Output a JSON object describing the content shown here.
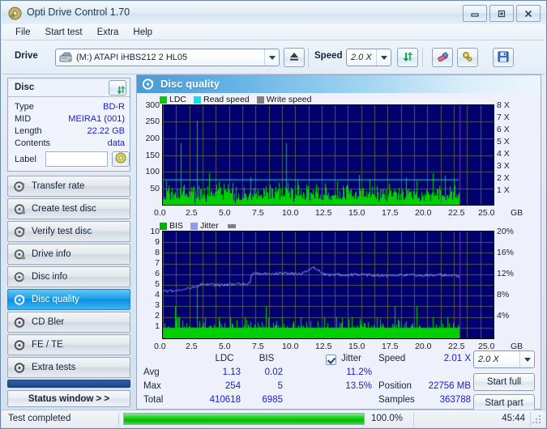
{
  "window": {
    "title": "Opti Drive Control 1.70",
    "icon": "app-disc-icon",
    "buttons": {
      "minimize": "minimize-icon",
      "maximize": "maximize-icon",
      "close": "close-icon"
    }
  },
  "menu": {
    "items": [
      "File",
      "Start test",
      "Extra",
      "Help"
    ]
  },
  "toolbar": {
    "drive_label": "Drive",
    "drive_value": "(M:)  ATAPI iHBS212  2 HL05",
    "eject_icon": "eject-icon",
    "speed_label": "Speed",
    "speed_value": "2.0 X",
    "refresh_icon": "refresh-arrows-icon",
    "erase_icon": "eraser-icon",
    "settings_icon": "tools-icon",
    "save_icon": "floppy-save-icon"
  },
  "disc_panel": {
    "title": "Disc",
    "refresh_icon": "refresh-arrows-icon",
    "rows": [
      {
        "key": "Type",
        "value": "BD-R"
      },
      {
        "key": "MID",
        "value": "MEIRA1 (001)"
      },
      {
        "key": "Length",
        "value": "22.22 GB"
      },
      {
        "key": "Contents",
        "value": "data"
      }
    ],
    "label_key": "Label",
    "label_value": "",
    "label_placeholder": "",
    "label_icon": "disc-icon"
  },
  "sidebar": {
    "items": [
      {
        "label": "Transfer rate",
        "icon": "disc-speed-icon",
        "active": false
      },
      {
        "label": "Create test disc",
        "icon": "disc-burn-icon",
        "active": false
      },
      {
        "label": "Verify test disc",
        "icon": "disc-check-icon",
        "active": false
      },
      {
        "label": "Drive info",
        "icon": "drive-info-icon",
        "active": false
      },
      {
        "label": "Disc info",
        "icon": "disc-info-icon",
        "active": false
      },
      {
        "label": "Disc quality",
        "icon": "disc-quality-icon",
        "active": true
      },
      {
        "label": "CD Bler",
        "icon": "disc-bler-icon",
        "active": false
      },
      {
        "label": "FE / TE",
        "icon": "disc-fete-icon",
        "active": false
      },
      {
        "label": "Extra tests",
        "icon": "disc-extra-icon",
        "active": false
      }
    ],
    "status_window_button": "Status window > >"
  },
  "panel": {
    "header_title": "Disc quality",
    "header_icon": "disc-quality-icon"
  },
  "stats": {
    "col_headers": [
      "LDC",
      "BIS"
    ],
    "jitter_label": "Jitter",
    "jitter_checked": true,
    "rows": [
      {
        "name": "Avg",
        "ldc": "1.13",
        "bis": "0.02",
        "jitter": "11.2%"
      },
      {
        "name": "Max",
        "ldc": "254",
        "bis": "5",
        "jitter": "13.5%"
      },
      {
        "name": "Total",
        "ldc": "410618",
        "bis": "6985",
        "jitter": ""
      }
    ],
    "right": [
      {
        "key": "Speed",
        "value": "2.01 X"
      },
      {
        "key": "Position",
        "value": "22756 MB"
      },
      {
        "key": "Samples",
        "value": "363788"
      }
    ],
    "speed_select": "2.0 X",
    "start_full": "Start full",
    "start_part": "Start part"
  },
  "statusbar": {
    "message": "Test completed",
    "percent": "100.0%",
    "percent_value": 100,
    "elapsed": "45:44"
  },
  "chart_data": [
    {
      "id": "top-chart",
      "type": "line",
      "title": "LDC / Read speed",
      "legend": [
        {
          "name": "LDC",
          "color": "#00d000"
        },
        {
          "name": "Read speed",
          "color": "#00e5e5"
        },
        {
          "name": "Write speed",
          "color": "#808080"
        }
      ],
      "legend_position": "top-left",
      "xlabel": "GB",
      "xlim": [
        0,
        25
      ],
      "xticks": [
        0.0,
        2.5,
        5.0,
        7.5,
        10.0,
        12.5,
        15.0,
        17.5,
        20.0,
        22.5,
        25.0
      ],
      "xticklabels": [
        "0.0",
        "2.5",
        "5.0",
        "7.5",
        "10.0",
        "12.5",
        "15.0",
        "17.5",
        "20.0",
        "22.5",
        "25.0"
      ],
      "ylabel_left": "LDC",
      "ylim_left": [
        0,
        300
      ],
      "yticks_left": [
        50,
        100,
        150,
        200,
        250,
        300
      ],
      "yticklabels_left": [
        "50",
        "100",
        "150",
        "200",
        "250",
        "300"
      ],
      "ylabel_right": "X",
      "ylim_right": [
        0,
        8
      ],
      "yticks_right": [
        1,
        2,
        3,
        4,
        5,
        6,
        7,
        8
      ],
      "yticklabels_right": [
        "1 X",
        "2 X",
        "3 X",
        "4 X",
        "5 X",
        "6 X",
        "7 X",
        "8 X"
      ],
      "grid": true,
      "plot_bg": "#00006e",
      "data_end_marker_x": 22.4,
      "data_end_marker_color": "#d000d0",
      "series": [
        {
          "name": "Read speed",
          "color": "#00e5e5",
          "axis": "right",
          "kind": "line",
          "x": [
            0.05,
            1.0,
            3.0,
            6.0,
            9.0,
            12.0,
            15.0,
            18.0,
            21.0,
            22.4
          ],
          "values": [
            2.01,
            2.01,
            2.01,
            2.01,
            2.01,
            2.01,
            2.01,
            2.01,
            2.01,
            2.01
          ]
        },
        {
          "name": "LDC",
          "color": "#00d000",
          "axis": "left",
          "kind": "spike",
          "baseline": 14,
          "avg": 1.13,
          "max": 254,
          "notable_spikes": [
            {
              "x": 0.25,
              "y": 72
            },
            {
              "x": 0.45,
              "y": 58
            },
            {
              "x": 1.35,
              "y": 186
            },
            {
              "x": 2.6,
              "y": 254
            },
            {
              "x": 3.5,
              "y": 96
            },
            {
              "x": 4.2,
              "y": 70
            },
            {
              "x": 5.3,
              "y": 66
            },
            {
              "x": 6.6,
              "y": 84
            },
            {
              "x": 8.1,
              "y": 60
            },
            {
              "x": 9.3,
              "y": 186
            },
            {
              "x": 10.2,
              "y": 74
            },
            {
              "x": 11.6,
              "y": 62
            },
            {
              "x": 13.2,
              "y": 70
            },
            {
              "x": 14.8,
              "y": 90
            },
            {
              "x": 15.6,
              "y": 76
            },
            {
              "x": 17.1,
              "y": 64
            },
            {
              "x": 18.4,
              "y": 82
            },
            {
              "x": 19.2,
              "y": 72
            },
            {
              "x": 20.4,
              "y": 96
            },
            {
              "x": 21.3,
              "y": 88
            },
            {
              "x": 22.0,
              "y": 74
            }
          ]
        }
      ]
    },
    {
      "id": "bottom-chart",
      "type": "line",
      "title": "BIS / Jitter",
      "legend": [
        {
          "name": "BIS",
          "color": "#00b200"
        },
        {
          "name": "Jitter",
          "color": "#8f9cf0"
        }
      ],
      "legend_position": "top-left",
      "xlabel": "GB",
      "xlim": [
        0,
        25
      ],
      "xticks": [
        0.0,
        2.5,
        5.0,
        7.5,
        10.0,
        12.5,
        15.0,
        17.5,
        20.0,
        22.5,
        25.0
      ],
      "xticklabels": [
        "0.0",
        "2.5",
        "5.0",
        "7.5",
        "10.0",
        "12.5",
        "15.0",
        "17.5",
        "20.0",
        "22.5",
        "25.0"
      ],
      "ylabel_left": "BIS",
      "ylim_left": [
        0,
        10
      ],
      "yticks_left": [
        1,
        2,
        3,
        4,
        5,
        6,
        7,
        8,
        9,
        10
      ],
      "yticklabels_left": [
        "1",
        "2",
        "3",
        "4",
        "5",
        "6",
        "7",
        "8",
        "9",
        "10"
      ],
      "ylabel_right": "%",
      "ylim_right": [
        0,
        20
      ],
      "yticks_right": [
        4,
        8,
        12,
        16,
        20
      ],
      "yticklabels_right": [
        "4%",
        "8%",
        "12%",
        "16%",
        "20%"
      ],
      "grid": true,
      "plot_bg": "#00006e",
      "data_end_marker_x": 22.4,
      "data_end_marker_color": "#d000d0",
      "series": [
        {
          "name": "Jitter",
          "color": "#8f9cf0",
          "axis": "right",
          "kind": "line",
          "x": [
            0.1,
            1.0,
            2.0,
            2.9,
            4.0,
            5.0,
            6.0,
            6.55,
            6.7,
            7.5,
            8.5,
            9.5,
            10.5,
            11.4,
            11.8,
            12.3,
            13.0,
            14.0,
            15.0,
            16.0,
            17.0,
            18.0,
            19.0,
            20.0,
            21.0,
            22.0,
            22.4
          ],
          "values": [
            8.8,
            9.0,
            9.4,
            10.1,
            10.0,
            10.1,
            10.1,
            10.2,
            12.0,
            12.1,
            12.1,
            12.2,
            12.1,
            13.2,
            12.6,
            11.9,
            11.9,
            11.9,
            11.9,
            11.8,
            11.7,
            11.9,
            11.8,
            11.8,
            11.9,
            11.8,
            11.5
          ],
          "avg": 11.2,
          "max": 13.5
        },
        {
          "name": "BIS",
          "color": "#00d000",
          "axis": "left",
          "kind": "spike",
          "baseline": 1,
          "avg": 0.02,
          "max": 5,
          "notable_spikes": [
            {
              "x": 0.9,
              "y": 3
            },
            {
              "x": 1.05,
              "y": 2
            },
            {
              "x": 1.2,
              "y": 2
            },
            {
              "x": 2.55,
              "y": 5
            },
            {
              "x": 2.6,
              "y": 1
            },
            {
              "x": 2.68,
              "y": 1
            },
            {
              "x": 3.2,
              "y": 2
            },
            {
              "x": 4.2,
              "y": 2
            },
            {
              "x": 5.1,
              "y": 2
            },
            {
              "x": 6.2,
              "y": 2
            },
            {
              "x": 7.8,
              "y": 3
            },
            {
              "x": 9.0,
              "y": 2
            },
            {
              "x": 10.4,
              "y": 2
            },
            {
              "x": 12.2,
              "y": 2
            },
            {
              "x": 13.1,
              "y": 2
            },
            {
              "x": 14.3,
              "y": 2
            },
            {
              "x": 16.2,
              "y": 2
            },
            {
              "x": 17.5,
              "y": 3
            },
            {
              "x": 19.2,
              "y": 3
            },
            {
              "x": 20.4,
              "y": 2
            },
            {
              "x": 21.5,
              "y": 2
            }
          ]
        }
      ]
    }
  ]
}
